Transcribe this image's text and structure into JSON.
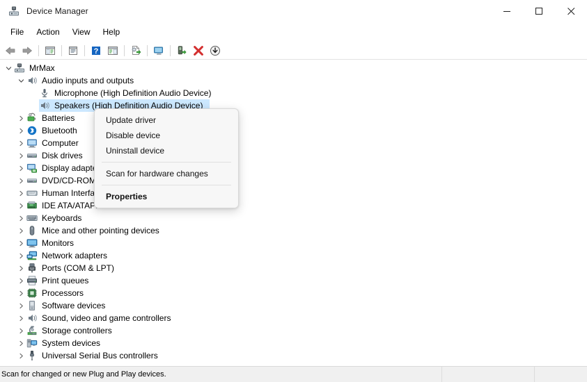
{
  "window": {
    "title": "Device Manager",
    "icon": "device-manager-icon",
    "controls": {
      "minimize": "Minimize",
      "maximize": "Maximize",
      "close": "Close"
    }
  },
  "menubar": {
    "items": [
      {
        "label": "File",
        "name": "menu-file"
      },
      {
        "label": "Action",
        "name": "menu-action"
      },
      {
        "label": "View",
        "name": "menu-view"
      },
      {
        "label": "Help",
        "name": "menu-help"
      }
    ]
  },
  "toolbar": {
    "buttons": [
      {
        "icon": "back-arrow-icon",
        "tooltip": "Back"
      },
      {
        "icon": "forward-arrow-icon",
        "tooltip": "Forward"
      },
      {
        "icon": "show-hide-console-tree-icon",
        "tooltip": "Show/Hide Console Tree"
      },
      {
        "icon": "properties-icon",
        "tooltip": "Properties"
      },
      {
        "icon": "help-icon",
        "tooltip": "Help"
      },
      {
        "icon": "show-hide-action-pane-icon",
        "tooltip": "Show/Hide Action Pane"
      },
      {
        "icon": "update-driver-icon",
        "tooltip": "Update Driver Software"
      },
      {
        "icon": "scan-hardware-changes-icon",
        "tooltip": "Scan for hardware changes"
      },
      {
        "icon": "enable-device-icon",
        "tooltip": "Enable device"
      },
      {
        "icon": "uninstall-device-icon",
        "tooltip": "Uninstall device"
      },
      {
        "icon": "disable-device-icon",
        "tooltip": "Disable device"
      }
    ]
  },
  "tree": {
    "nodes": [
      {
        "label": "MrMax",
        "level": 0,
        "expanded": true,
        "hasChildren": true,
        "icon": "computer-root-icon",
        "selected": false,
        "truncated": false
      },
      {
        "label": "Audio inputs and outputs",
        "level": 1,
        "expanded": true,
        "hasChildren": true,
        "icon": "speaker-icon",
        "selected": false,
        "truncated": false
      },
      {
        "label": "Microphone (High Definition Audio Device)",
        "level": 2,
        "expanded": false,
        "hasChildren": false,
        "icon": "microphone-icon",
        "selected": false,
        "truncated": false
      },
      {
        "label": "Speakers (High Definition Audio Device)",
        "level": 2,
        "expanded": false,
        "hasChildren": false,
        "icon": "speaker-icon",
        "selected": true,
        "truncated": false
      },
      {
        "label": "Batteries",
        "level": 1,
        "expanded": false,
        "hasChildren": true,
        "icon": "battery-icon",
        "selected": false,
        "truncated": true
      },
      {
        "label": "Bluetooth",
        "level": 1,
        "expanded": false,
        "hasChildren": true,
        "icon": "bluetooth-icon",
        "selected": false,
        "truncated": true
      },
      {
        "label": "Computer",
        "level": 1,
        "expanded": false,
        "hasChildren": true,
        "icon": "computer-icon",
        "selected": false,
        "truncated": true
      },
      {
        "label": "Disk drives",
        "level": 1,
        "expanded": false,
        "hasChildren": true,
        "icon": "disk-drive-icon",
        "selected": false,
        "truncated": true
      },
      {
        "label": "Display adapters",
        "level": 1,
        "expanded": false,
        "hasChildren": true,
        "icon": "display-adapter-icon",
        "selected": false,
        "truncated": true
      },
      {
        "label": "DVD/CD-ROM drives",
        "level": 1,
        "expanded": false,
        "hasChildren": true,
        "icon": "dvd-drive-icon",
        "selected": false,
        "truncated": true
      },
      {
        "label": "Human Interface Devices",
        "level": 1,
        "expanded": false,
        "hasChildren": true,
        "icon": "hid-icon",
        "selected": false,
        "truncated": true
      },
      {
        "label": "IDE ATA/ATAPI controllers",
        "level": 1,
        "expanded": false,
        "hasChildren": true,
        "icon": "ide-controller-icon",
        "selected": false,
        "truncated": false
      },
      {
        "label": "Keyboards",
        "level": 1,
        "expanded": false,
        "hasChildren": true,
        "icon": "keyboard-icon",
        "selected": false,
        "truncated": false
      },
      {
        "label": "Mice and other pointing devices",
        "level": 1,
        "expanded": false,
        "hasChildren": true,
        "icon": "mouse-icon",
        "selected": false,
        "truncated": false
      },
      {
        "label": "Monitors",
        "level": 1,
        "expanded": false,
        "hasChildren": true,
        "icon": "monitor-icon",
        "selected": false,
        "truncated": false
      },
      {
        "label": "Network adapters",
        "level": 1,
        "expanded": false,
        "hasChildren": true,
        "icon": "network-adapter-icon",
        "selected": false,
        "truncated": false
      },
      {
        "label": "Ports (COM & LPT)",
        "level": 1,
        "expanded": false,
        "hasChildren": true,
        "icon": "port-icon",
        "selected": false,
        "truncated": false
      },
      {
        "label": "Print queues",
        "level": 1,
        "expanded": false,
        "hasChildren": true,
        "icon": "printer-icon",
        "selected": false,
        "truncated": false
      },
      {
        "label": "Processors",
        "level": 1,
        "expanded": false,
        "hasChildren": true,
        "icon": "processor-icon",
        "selected": false,
        "truncated": false
      },
      {
        "label": "Software devices",
        "level": 1,
        "expanded": false,
        "hasChildren": true,
        "icon": "software-device-icon",
        "selected": false,
        "truncated": false
      },
      {
        "label": "Sound, video and game controllers",
        "level": 1,
        "expanded": false,
        "hasChildren": true,
        "icon": "speaker-icon",
        "selected": false,
        "truncated": false
      },
      {
        "label": "Storage controllers",
        "level": 1,
        "expanded": false,
        "hasChildren": true,
        "icon": "storage-controller-icon",
        "selected": false,
        "truncated": false
      },
      {
        "label": "System devices",
        "level": 1,
        "expanded": false,
        "hasChildren": true,
        "icon": "system-device-icon",
        "selected": false,
        "truncated": false
      },
      {
        "label": "Universal Serial Bus controllers",
        "level": 1,
        "expanded": false,
        "hasChildren": true,
        "icon": "usb-icon",
        "selected": false,
        "truncated": false
      }
    ]
  },
  "context_menu": {
    "visible": true,
    "target": "Speakers (High Definition Audio Device)",
    "items": [
      {
        "label": "Update driver",
        "type": "item",
        "bold": false,
        "name": "ctx-update-driver"
      },
      {
        "label": "Disable device",
        "type": "item",
        "bold": false,
        "name": "ctx-disable-device"
      },
      {
        "label": "Uninstall device",
        "type": "item",
        "bold": false,
        "name": "ctx-uninstall-device"
      },
      {
        "type": "separator"
      },
      {
        "label": "Scan for hardware changes",
        "type": "item",
        "bold": false,
        "name": "ctx-scan-hardware-changes"
      },
      {
        "type": "separator"
      },
      {
        "label": "Properties",
        "type": "item",
        "bold": true,
        "name": "ctx-properties"
      }
    ]
  },
  "statusbar": {
    "message": "Scan for changed or new Plug and Play devices."
  },
  "colors": {
    "selection": "#cce8ff",
    "window_bg": "#ffffff",
    "statusbar_bg": "#f0f0f0",
    "menu_bg": "#f7f7f7",
    "close_hover": "#e81123",
    "accent": "#0078d7"
  }
}
